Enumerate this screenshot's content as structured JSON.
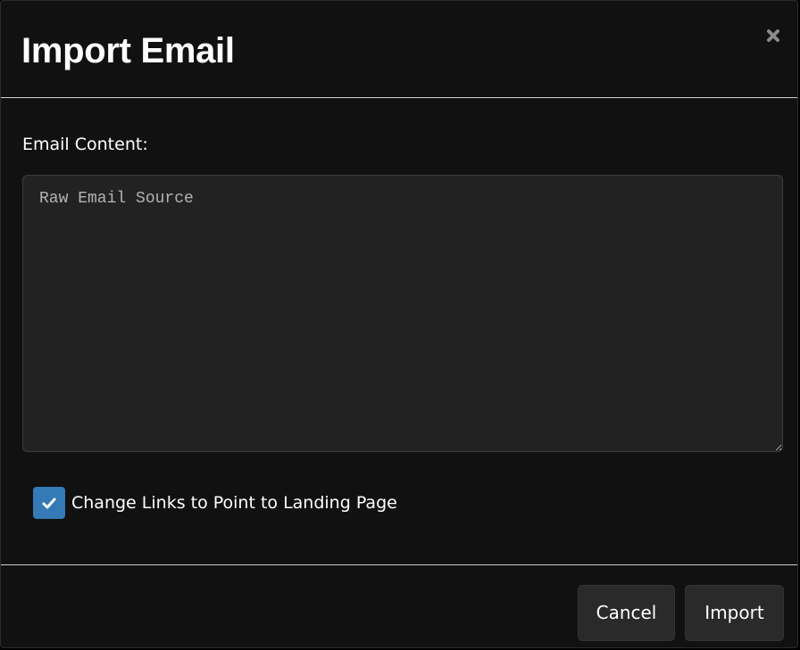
{
  "modal": {
    "title": "Import Email",
    "close_icon": "close-icon"
  },
  "form": {
    "email_content_label": "Email Content:",
    "textarea_placeholder": "Raw Email Source",
    "textarea_value": "",
    "change_links": {
      "label": "Change Links to Point to Landing Page",
      "checked": true,
      "icon": "checkmark-icon"
    }
  },
  "footer": {
    "cancel_label": "Cancel",
    "import_label": "Import"
  },
  "colors": {
    "modal_background": "#111111",
    "textarea_background": "#222222",
    "checkbox_accent": "#337ab7",
    "button_background": "#2a2a2a",
    "divider": "#cfcfcf"
  }
}
